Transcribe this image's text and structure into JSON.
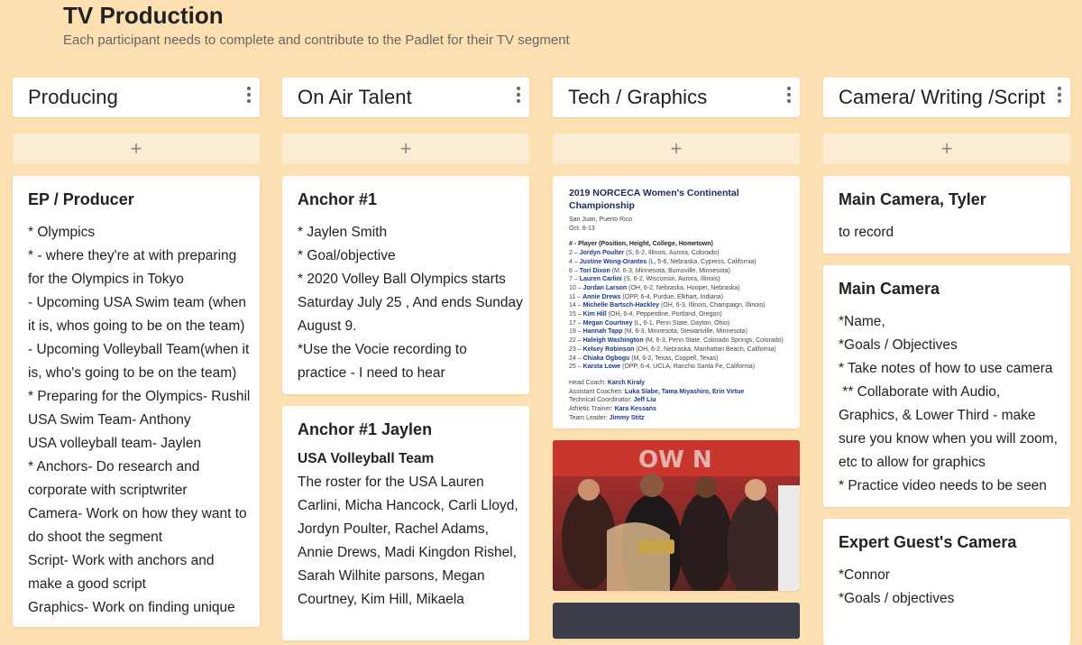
{
  "board": {
    "title": "TV Production",
    "subtitle": "Each participant needs to complete and contribute to the Padlet for their TV segment"
  },
  "add_label": "+",
  "columns": [
    {
      "title": "Producing",
      "posts": [
        {
          "title": "EP / Producer",
          "lines": [
            "* Olympics",
            "* - where they're at with preparing",
            "for the Olympics in Tokyo",
            "- Upcoming USA Swim team (when",
            "it is, whos going to be on the team)",
            "- Upcoming Volleyball Team(when it",
            "is, who's going to be on the team)",
            "* Preparing for the Olympics- Rushil",
            "USA  Swim Team- Anthony",
            "USA volleyball team- Jaylen",
            "* Anchors- Do research and",
            "corporate with scriptwriter",
            "Camera- Work on how they want to",
            "do shoot the segment",
            "Script- Work with anchors and",
            "make a good script",
            "Graphics- Work on finding unique"
          ]
        }
      ]
    },
    {
      "title": "On Air Talent",
      "posts": [
        {
          "title": "Anchor #1",
          "lines": [
            "* Jaylen Smith",
            "* Goal/objective",
            "* 2020 Volley Ball Olympics starts",
            "Saturday July 25 , And ends Sunday",
            "August 9.",
            "*Use the Vocie recording to",
            "practice - I need to hear"
          ]
        },
        {
          "title": "Anchor #1 Jaylen",
          "subheading": "USA Volleyball Team",
          "lines": [
            "The roster for the USA Lauren",
            "Carlini, Micha Hancock, Carli Lloyd,",
            "Jordyn Poulter, Rachel Adams,",
            "Annie Drews, Madi Kingdon Rishel,",
            "Sarah Wilhite parsons, Megan",
            "Courtney, Kim Hill, Mikaela"
          ]
        }
      ]
    },
    {
      "title": "Tech / Graphics",
      "roster": {
        "title": "2019 NORCECA Women's Continental Championship",
        "location": "San Juan, Puerto Rico",
        "dates": "Oct. 8-13",
        "header": "# - Player (Position, Height, College, Hometown)",
        "players": [
          {
            "num": "2 –",
            "name": "Jordyn Poulter",
            "info": "(S, 6-2, Illinois, Aurora, Colorado)"
          },
          {
            "num": "4 –",
            "name": "Justine Wong-Orantes",
            "info": "(L, 5-6, Nebraska, Cypress, California)"
          },
          {
            "num": "6 –",
            "name": "Tori Dixon",
            "info": "(M, 6-3, Minnesota, Burnsville, Minnesota)"
          },
          {
            "num": "7 –",
            "name": "Lauren Carlini",
            "info": "(S, 6-2, Wisconsin, Aurora, Illinois)"
          },
          {
            "num": "10 –",
            "name": "Jordan Larson",
            "info": "(OH, 6-2, Nebraska, Hooper, Nebraska)"
          },
          {
            "num": "11 –",
            "name": "Annie Drews",
            "info": "(OPP, 6-4, Purdue, Elkhart, Indiana)"
          },
          {
            "num": "14 –",
            "name": "Michelle Bartsch-Hackley",
            "info": "(OH, 6-3, Illinois, Champaign, Illinois)"
          },
          {
            "num": "15 –",
            "name": "Kim Hill",
            "info": "(OH, 6-4, Pepperdine, Portland, Oregon)"
          },
          {
            "num": "17 –",
            "name": "Megan Courtney",
            "info": "(L, 6-1, Penn State, Dayton, Ohio)"
          },
          {
            "num": "19 –",
            "name": "Hannah Tapp",
            "info": "(M, 6-3, Minnesota, Stewartville, Minnesota)"
          },
          {
            "num": "22 –",
            "name": "Haleigh Washington",
            "info": "(M, 6-3, Penn State, Colorado Springs, Colorado)"
          },
          {
            "num": "23 –",
            "name": "Kelsey Robinson",
            "info": "(OH, 6-2, Nebraska, Manhattan Beach, California)"
          },
          {
            "num": "24 –",
            "name": "Chiaka Ogbogu",
            "info": "(M, 6-2, Texas, Coppell, Texas)"
          },
          {
            "num": "25 –",
            "name": "Karsta Lowe",
            "info": "(OPP, 6-4, UCLA, Rancho Santa Fe, California)"
          }
        ],
        "staff": [
          {
            "label": "Head Coach:",
            "name": "Karch Kiraly"
          },
          {
            "label": "Assistant Coaches:",
            "name": "Luka Slabe, Tama Miyashiro, Erin Virtue"
          },
          {
            "label": "Technical Coordinator:",
            "name": "Jeff Liu"
          },
          {
            "label": "Athletic Trainer:",
            "name": "Kara Kessans"
          },
          {
            "label": "Team Leader:",
            "name": "Jimmy Stitz"
          }
        ]
      }
    },
    {
      "title": "Camera/ Writing /Script",
      "posts": [
        {
          "title": "Main Camera, Tyler",
          "lines": [
            "to record"
          ]
        },
        {
          "title": "Main Camera",
          "lines": [
            "*Name,",
            "*Goals / Objectives",
            "* Take notes of how to use camera",
            " ** Collaborate with Audio,",
            "Graphics, & Lower Third - make",
            "sure you know when you will zoom,",
            "etc to allow for graphics",
            "* Practice video needs to be seen"
          ]
        },
        {
          "title": "Expert Guest's Camera",
          "lines": [
            "*Connor",
            "*Goals / objectives"
          ]
        }
      ]
    }
  ],
  "colors": {
    "background": "#fde0b2",
    "card": "#ffffff",
    "add_button": "#fcecd3",
    "roster_name": "#1a3a8a"
  }
}
